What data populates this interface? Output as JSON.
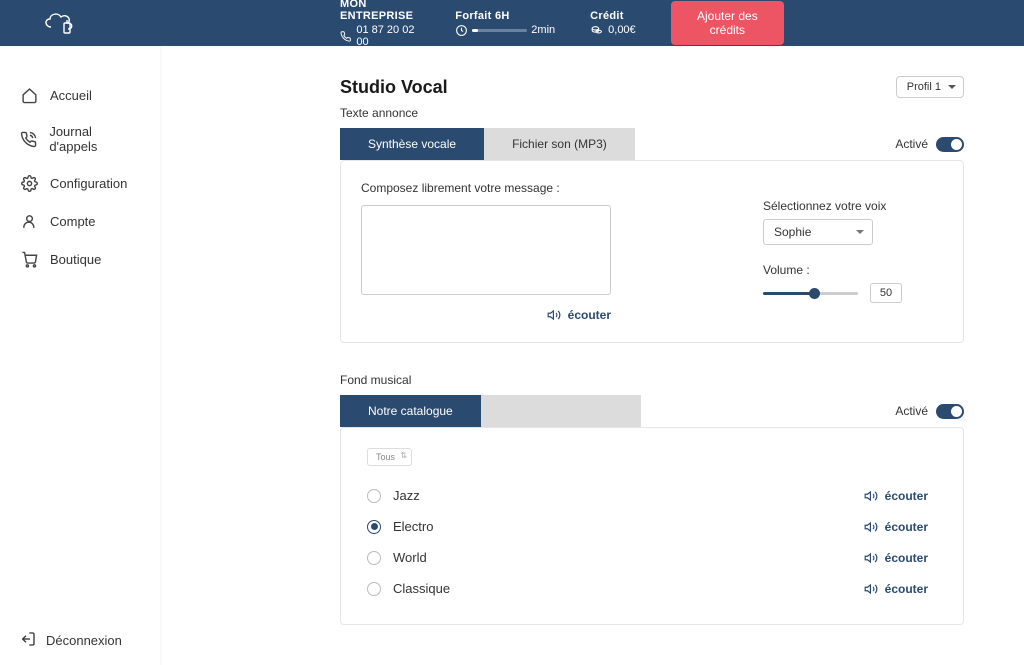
{
  "header": {
    "company": "MON ENTREPRISE",
    "phone": "01 87 20 02 00",
    "plan_label": "Forfait 6H",
    "plan_remaining": "2min",
    "credit_label": "Crédit",
    "credit_value": "0,00€",
    "add_credits_btn": "Ajouter des crédits"
  },
  "sidebar": {
    "items": [
      {
        "label": "Accueil"
      },
      {
        "label": "Journal d'appels"
      },
      {
        "label": "Configuration"
      },
      {
        "label": "Compte"
      },
      {
        "label": "Boutique"
      }
    ],
    "logout": "Déconnexion"
  },
  "page": {
    "title": "Studio Vocal",
    "profile_selected": "Profil 1"
  },
  "announcement": {
    "section_label": "Texte annonce",
    "tab_synthesis": "Synthèse vocale",
    "tab_file": "Fichier son (MP3)",
    "toggle_label": "Activé",
    "compose_label": "Composez librement votre message :",
    "listen": "écouter",
    "voice_label": "Sélectionnez votre voix",
    "voice_selected": "Sophie",
    "volume_label": "Volume :",
    "volume_value": "50"
  },
  "music": {
    "section_label": "Fond musical",
    "tab_catalog": "Notre catalogue",
    "toggle_label": "Activé",
    "filter_selected": "Tous",
    "listen": "écouter",
    "genres": [
      {
        "name": "Jazz",
        "selected": false
      },
      {
        "name": "Electro",
        "selected": true
      },
      {
        "name": "World",
        "selected": false
      },
      {
        "name": "Classique",
        "selected": false
      }
    ]
  }
}
